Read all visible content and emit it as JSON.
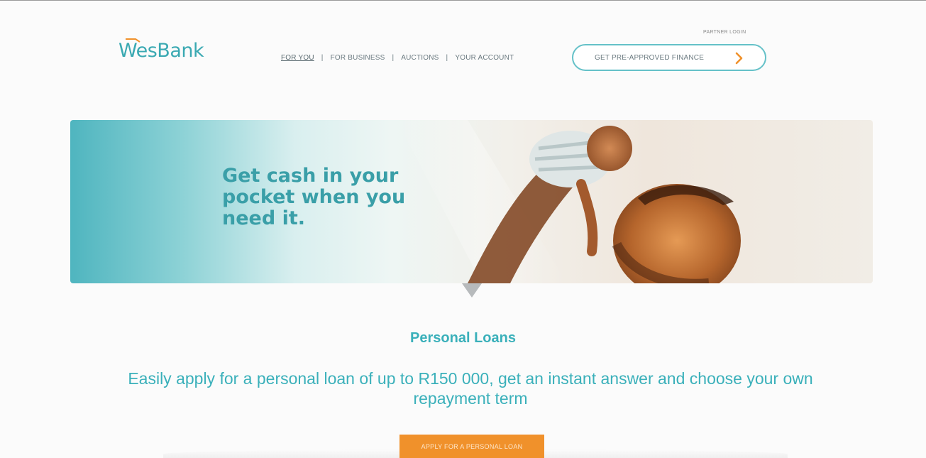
{
  "brand": {
    "logo_text": "WesBank",
    "accent_color": "#3aa9b2",
    "cta_color": "#f0912b"
  },
  "header": {
    "partner_login": "PARTNER LOGIN",
    "nav": [
      {
        "label": "FOR YOU",
        "active": true
      },
      {
        "label": "FOR BUSINESS",
        "active": false
      },
      {
        "label": "AUCTIONS",
        "active": false
      },
      {
        "label": "YOUR ACCOUNT",
        "active": false
      }
    ],
    "separator": "|",
    "cta": {
      "label": "GET PRE-APPROVED FINANCE",
      "icon": "chevron-right-icon"
    }
  },
  "hero": {
    "headline": "Get cash in your pocket when you need it.",
    "image": "father-lifting-baby-photo"
  },
  "main": {
    "title": "Personal Loans",
    "lead": "Easily apply for a personal loan of up to R150 000, get an instant answer and choose your own repayment term",
    "apply_label": "APPLY FOR A PERSONAL LOAN"
  }
}
